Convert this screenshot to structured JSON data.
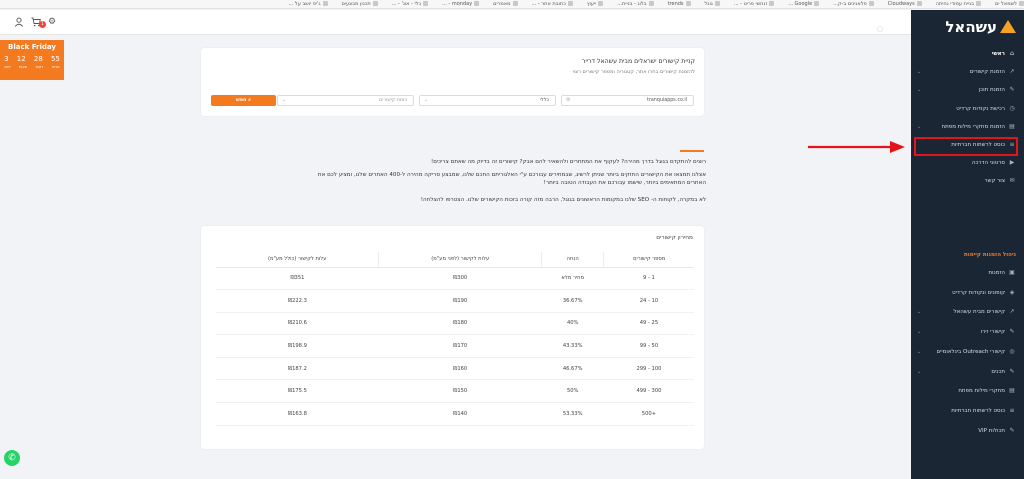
{
  "bookmarks": [
    "לשמאל ים",
    "בניית עמודי נחיתה",
    "Cloudways",
    "פלאגינים ב-ק...",
    "Google ...",
    "זנחשי פריט - ...",
    "גוגל",
    "trends",
    "בלוג - בניית...",
    "ייעוץ",
    "כתובת אתר - ...",
    "מאמרים",
    "monday - ...",
    "כלי - אונ' - ...",
    "תכנון מבצעים",
    "ג'יפ יושב על ..."
  ],
  "topbar": {
    "cart_count": "1"
  },
  "black_friday": {
    "title": "Black Friday",
    "numbers": [
      "3",
      "12",
      "28",
      "55"
    ],
    "labels": [
      "ימים",
      "שעות",
      "דקות",
      "שניות"
    ]
  },
  "sidebar": {
    "logo": "עשהאל",
    "items": [
      {
        "label": "ראשי",
        "icon": "⌂",
        "chev": false
      },
      {
        "label": "הזמנת קישורים",
        "icon": "↗",
        "chev": true
      },
      {
        "label": "הזמנת תוכן",
        "icon": "✎",
        "chev": true
      },
      {
        "label": "רכישת נקודות קרדיט",
        "icon": "◷",
        "chev": false
      },
      {
        "label": "הזמנת מחקרי מילות מפתח",
        "icon": "▤",
        "chev": true
      },
      {
        "label": "כוסט לרשתות חברתיות",
        "icon": "≡",
        "chev": false
      },
      {
        "label": "סרטוני הדרכה",
        "icon": "▶",
        "chev": false
      },
      {
        "label": "צור קשר",
        "icon": "✉",
        "chev": false
      }
    ],
    "section2_title": "ניהול הזמנות קיימות",
    "items2": [
      {
        "label": "הזמנות",
        "icon": "▣",
        "chev": false
      },
      {
        "label": "קופונים ונקודות קרדיט",
        "icon": "◈",
        "chev": false
      },
      {
        "label": "קישורים מבית עשהאל",
        "icon": "↗",
        "chev": true
      },
      {
        "label": "קישורי זירו",
        "icon": "✎",
        "chev": true
      },
      {
        "label": "קישורי Outreach בינלאומיים",
        "icon": "◎",
        "chev": true
      },
      {
        "label": "תכנים",
        "icon": "✎",
        "chev": true
      },
      {
        "label": "מחקרי מילות מפתח",
        "icon": "▤",
        "chev": false
      },
      {
        "label": "כוסט לרשתות חברתיות",
        "icon": "≡",
        "chev": false
      },
      {
        "label": "תכולות VIP",
        "icon": "✎",
        "chev": false
      }
    ]
  },
  "card1": {
    "title": "קניית קישורים ישראלים מבית עשהאל דרייר",
    "subtitle": "להזמנת קישורים בחרו אתר, קטגוריה ומספר קישורים רצוי",
    "site_value": "tranquiapps.co.il",
    "category_value": "כללי",
    "quantity_placeholder": "כמות קישורים",
    "search_label": "חפש"
  },
  "text": {
    "p1": "רוצים להתקדם בגוגל בדרך מהירה? לעקוף את המתחרים ולהשאיר להם אבק? קישורים זה בדיוק מה שאתם צריכים!",
    "p2": "אצלנו תמצאו את הקישורים החזקים ביותר שניתן לרשיג, שבמחירים עבורכם ע\"י האלגוריתם החכם שלנו, שמבצע סריקה מהירה ל-400 האתרים שלנו, ומציע לכם את האתרים המתאימים ביותר, שישמו עבורכם את העבודה הטובה ביותר!",
    "p3": "לא במקרה, לקוחות ה- SEO שלנו במקומות הראשונים בגוגל, הרבה מזה קורה בזכות הקישורים שלנו. הצטרפו להצלחה!"
  },
  "pricing": {
    "title": "מחירון קישורים",
    "headers": [
      "מספר קישורים",
      "הנחה",
      "עלות לקישור (לפני מע\"מ)",
      "עלות לקישור (כולל מע\"מ)"
    ],
    "rows": [
      [
        "1 - 9",
        "מחיר מלא",
        "₪300",
        "₪351"
      ],
      [
        "10 - 24",
        "36.67%",
        "₪190",
        "₪222.3"
      ],
      [
        "25 - 49",
        "40%",
        "₪180",
        "₪210.6"
      ],
      [
        "50 - 99",
        "43.33%",
        "₪170",
        "₪198.9"
      ],
      [
        "100 - 299",
        "46.67%",
        "₪160",
        "₪187.2"
      ],
      [
        "300 - 499",
        "50%",
        "₪150",
        "₪175.5"
      ],
      [
        "+500",
        "53.33%",
        "₪140",
        "₪163.8"
      ]
    ]
  },
  "colors": {
    "accent": "#f47a20",
    "sidebar_bg": "#1b2634",
    "highlight": "#e4141b"
  }
}
